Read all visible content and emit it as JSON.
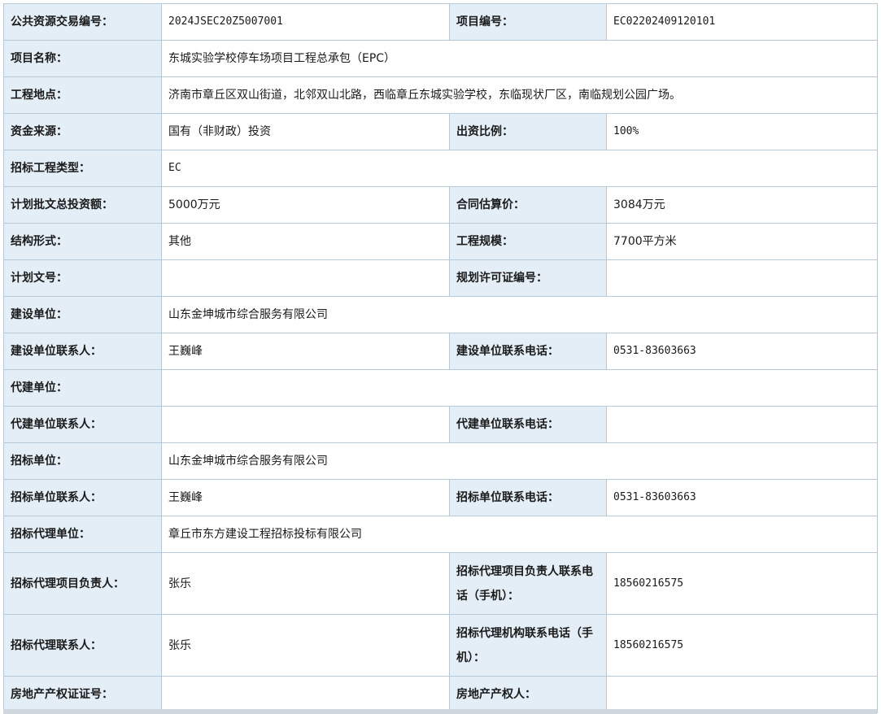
{
  "fields": {
    "trade_no": {
      "label": "公共资源交易编号：",
      "value": "2024JSEC20Z5007001"
    },
    "project_no": {
      "label": "项目编号：",
      "value": "EC02202409120101"
    },
    "project_name": {
      "label": "项目名称：",
      "value": "东城实验学校停车场项目工程总承包（EPC）"
    },
    "location": {
      "label": "工程地点：",
      "value": "济南市章丘区双山街道，北邻双山北路，西临章丘东城实验学校，东临现状厂区，南临规划公园广场。"
    },
    "fund_source": {
      "label": "资金来源：",
      "value": "国有（非财政）投资"
    },
    "invest_ratio": {
      "label": "出资比例：",
      "value": "100%"
    },
    "tender_type": {
      "label": "招标工程类型：",
      "value": "EC"
    },
    "plan_total": {
      "label": "计划批文总投资额：",
      "value": "5000万元"
    },
    "contract_estimate": {
      "label": "合同估算价：",
      "value": "3084万元"
    },
    "structure": {
      "label": "结构形式：",
      "value": "其他"
    },
    "scale": {
      "label": "工程规模：",
      "value": "7700平方米"
    },
    "plan_doc_no": {
      "label": "计划文号：",
      "value": ""
    },
    "permit_no": {
      "label": "规划许可证编号：",
      "value": ""
    },
    "builder": {
      "label": "建设单位：",
      "value": "山东金坤城市综合服务有限公司"
    },
    "builder_contact": {
      "label": "建设单位联系人：",
      "value": "王巍峰"
    },
    "builder_phone": {
      "label": "建设单位联系电话：",
      "value": "0531-83603663"
    },
    "agent_builder": {
      "label": "代建单位：",
      "value": ""
    },
    "agent_builder_contact": {
      "label": "代建单位联系人：",
      "value": ""
    },
    "agent_builder_phone": {
      "label": "代建单位联系电话：",
      "value": ""
    },
    "tenderer": {
      "label": "招标单位：",
      "value": "山东金坤城市综合服务有限公司"
    },
    "tenderer_contact": {
      "label": "招标单位联系人：",
      "value": "王巍峰"
    },
    "tenderer_phone": {
      "label": "招标单位联系电话：",
      "value": "0531-83603663"
    },
    "agency": {
      "label": "招标代理单位：",
      "value": "章丘市东方建设工程招标投标有限公司"
    },
    "agency_leader": {
      "label": "招标代理项目负责人：",
      "value": "张乐"
    },
    "agency_leader_phone": {
      "label": "招标代理项目负责人联系电话（手机）：",
      "value": "18560216575"
    },
    "agency_contact": {
      "label": "招标代理联系人：",
      "value": "张乐"
    },
    "agency_phone": {
      "label": "招标代理机构联系电话（手机）：",
      "value": "18560216575"
    },
    "property_cert": {
      "label": "房地产产权证证号：",
      "value": ""
    },
    "property_owner": {
      "label": "房地产产权人：",
      "value": ""
    }
  }
}
